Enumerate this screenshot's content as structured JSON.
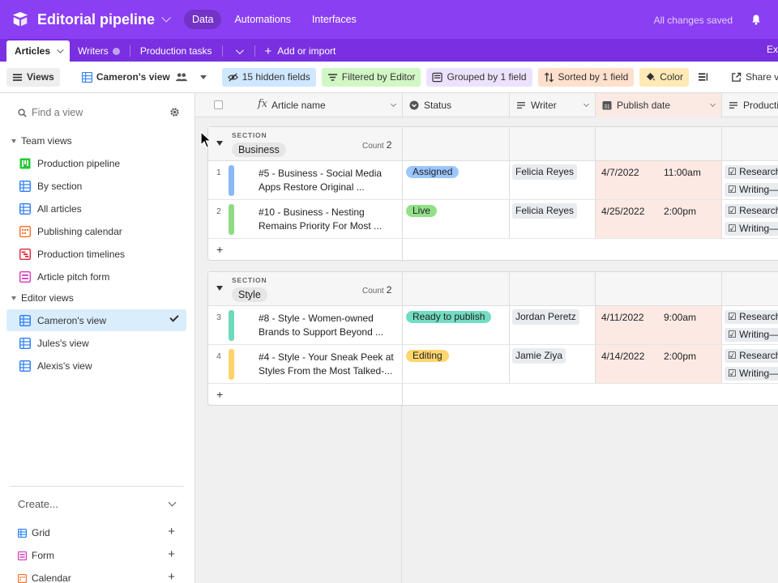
{
  "header": {
    "base_title": "Editorial pipeline",
    "nav": [
      "Data",
      "Automations",
      "Interfaces"
    ],
    "saved_status": "All changes saved"
  },
  "tabs": {
    "items": [
      "Articles",
      "Writers",
      "Production tasks"
    ],
    "add_label": "Add or import",
    "extra": "Ex"
  },
  "toolbar": {
    "views": "Views",
    "current_view": "Cameron's view",
    "hidden": "15 hidden fields",
    "filter": "Filtered by Editor",
    "group": "Grouped by 1 field",
    "sort": "Sorted by 1 field",
    "color": "Color",
    "share": "Share view"
  },
  "sidebar": {
    "find_placeholder": "Find a view",
    "team_views_label": "Team views",
    "team_views": [
      "Production pipeline",
      "By section",
      "All articles",
      "Publishing calendar",
      "Production timelines",
      "Article pitch form"
    ],
    "editor_views_label": "Editor views",
    "editor_views": [
      "Cameron's view",
      "Jules's view",
      "Alexis's view"
    ],
    "create_label": "Create...",
    "create_items": [
      "Grid",
      "Form",
      "Calendar"
    ]
  },
  "columns": [
    "Article name",
    "Status",
    "Writer",
    "Publish date",
    "Productio"
  ],
  "groups": [
    {
      "section_label": "SECTION",
      "name": "Business",
      "count_label": "Count",
      "count": "2",
      "rows": [
        {
          "num": "1",
          "title": "#5 - Business - Social Media Apps Restore Original ...",
          "status": "Assigned",
          "writer": "Felicia Reyes",
          "date": "4/7/2022",
          "time": "11:00am",
          "tasks": [
            "Research—",
            "Writing—A"
          ]
        },
        {
          "num": "2",
          "title": "#10 - Business - Nesting Remains Priority For Most ...",
          "status": "Live",
          "writer": "Felicia Reyes",
          "date": "4/25/2022",
          "time": "2:00pm",
          "tasks": [
            "Research—",
            "Writing—A"
          ]
        }
      ]
    },
    {
      "section_label": "SECTION",
      "name": "Style",
      "count_label": "Count",
      "count": "2",
      "rows": [
        {
          "num": "3",
          "title": "#8 - Style - Women-owned Brands to Support Beyond ...",
          "status": "Ready to publish",
          "writer": "Jordan Peretz",
          "date": "4/11/2022",
          "time": "9:00am",
          "tasks": [
            "Research—",
            "Writing—A"
          ]
        },
        {
          "num": "4",
          "title": "#4 - Style - Your Sneak Peek at Styles From the Most Talked-...",
          "status": "Editing",
          "writer": "Jamie Ziya",
          "date": "4/14/2022",
          "time": "2:00pm",
          "tasks": [
            "Research—",
            "Writing—A"
          ]
        }
      ]
    }
  ],
  "colors": {
    "brand": "#8b3ff2",
    "status_assigned": "#9cc7ff",
    "status_live": "#93e088",
    "status_ready": "#72ddc3",
    "status_editing": "#ffd66e",
    "bar_blue": "#8ab7f5",
    "bar_green": "#8fdb84",
    "bar_teal": "#6fd9bc",
    "bar_yellow": "#ffd36b"
  },
  "icons": {
    "logo": "base-logo-icon",
    "bell": "bell-icon",
    "grid": "grid-view-icon",
    "kanban": "kanban-view-icon",
    "calendar": "calendar-view-icon",
    "gantt": "gantt-view-icon",
    "form": "form-view-icon"
  }
}
